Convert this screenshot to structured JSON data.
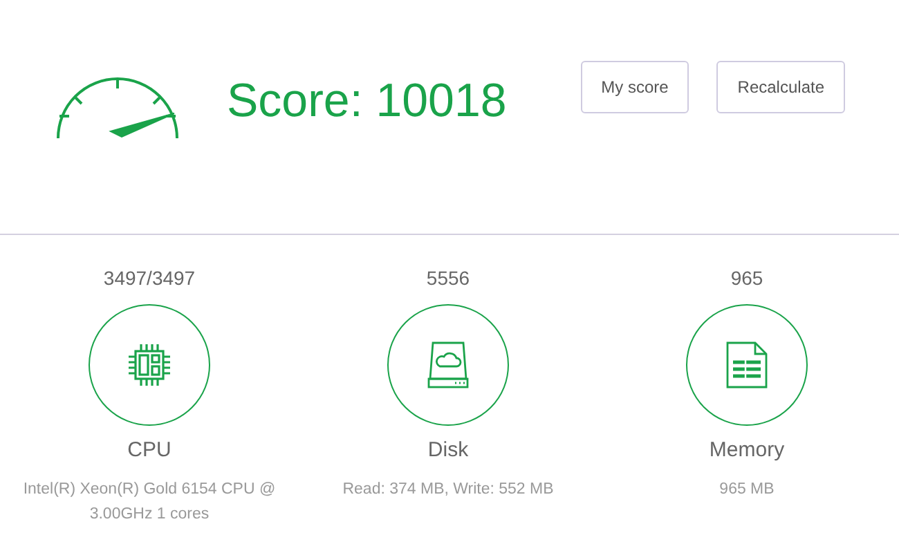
{
  "score": {
    "text": "Score: 10018"
  },
  "buttons": [
    {
      "label": "My score"
    },
    {
      "label": "Recalculate"
    }
  ],
  "metrics": [
    {
      "kind": "cpu",
      "value": "3497/3497",
      "name": "CPU",
      "detail": "Intel(R) Xeon(R) Gold 6154 CPU @ 3.00GHz 1 cores"
    },
    {
      "kind": "disk",
      "value": "5556",
      "name": "Disk",
      "detail": "Read: 374 MB, Write: 552 MB"
    },
    {
      "kind": "memory",
      "value": "965",
      "name": "Memory",
      "detail": "965 MB"
    }
  ]
}
